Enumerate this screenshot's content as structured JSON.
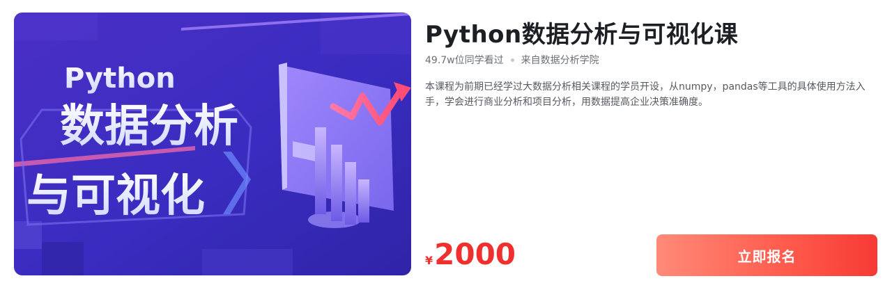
{
  "cover": {
    "line1": "Python",
    "line2": "数据分析",
    "line3": "与可视化"
  },
  "course": {
    "title": "Python数据分析与可视化课",
    "views": "49.7w位同学看过",
    "source": "来自数据分析学院",
    "description": "本课程为前期已经学过大数据分析相关课程的学员开设，从numpy，pandas等工具的具体使用方法入手，学会进行商业分析和项目分析，用数据提高企业决策准确度。"
  },
  "price": {
    "currency": "¥",
    "amount": "2000"
  },
  "actions": {
    "enroll_label": "立即报名"
  },
  "colors": {
    "price": "#f0302e",
    "button": "#ff5a4b",
    "cover_bg": "#3a2fc0"
  }
}
